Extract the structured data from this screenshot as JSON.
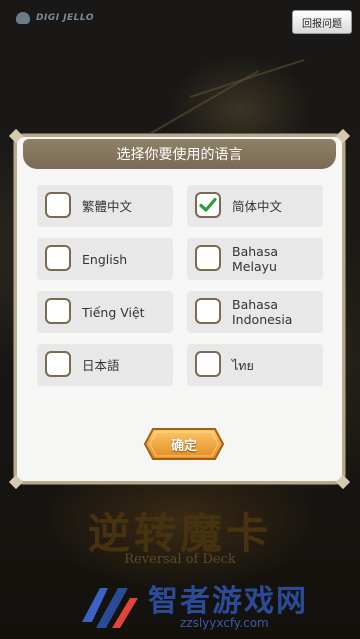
{
  "brand": {
    "logo_text": "DIGI JELLO"
  },
  "header": {
    "report_button": "回报问题"
  },
  "dialog": {
    "title": "选择你要使用的语言",
    "languages": [
      {
        "label": "繁體中文",
        "checked": false
      },
      {
        "label": "简体中文",
        "checked": true
      },
      {
        "label": "English",
        "checked": false
      },
      {
        "label_line1": "Bahasa",
        "label_line2": "Melayu",
        "checked": false
      },
      {
        "label": "Tiếng Việt",
        "checked": false
      },
      {
        "label_line1": "Bahasa",
        "label_line2": "Indonesia",
        "checked": false
      },
      {
        "label": "日本語",
        "checked": false
      },
      {
        "label": "ไทย",
        "checked": false
      }
    ],
    "confirm": "确定"
  },
  "background": {
    "game_title": "逆转魔卡",
    "game_subtitle": "Reversal of Deck"
  },
  "watermark": {
    "text": "智者游戏网",
    "url": "zzslyyxcfy.com"
  },
  "colors": {
    "accent_check": "#2e9e3a",
    "confirm_orange": "#f0a13a",
    "dialog_border": "#b7a98e",
    "header_brown": "#857760",
    "watermark_blue": "#2a4b97"
  }
}
